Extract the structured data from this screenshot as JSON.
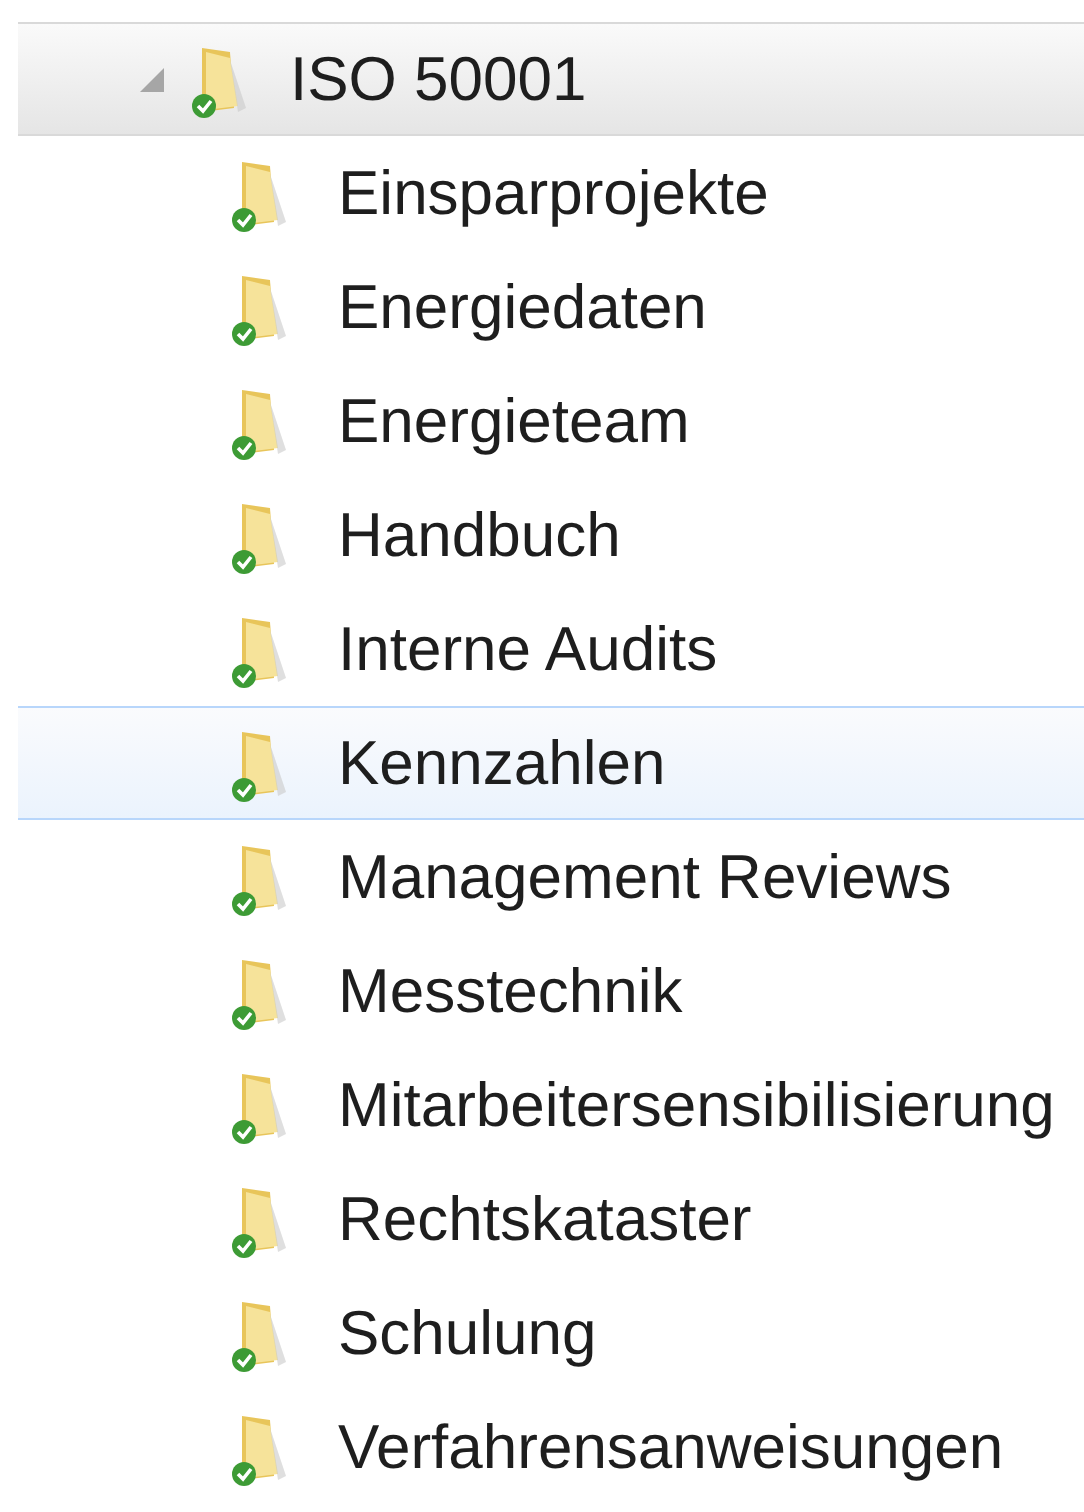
{
  "tree": {
    "label": "ISO 50001",
    "expanded": true,
    "selected": true,
    "children": [
      {
        "label": "Einsparprojekte",
        "selected": false,
        "hovered": false
      },
      {
        "label": "Energiedaten",
        "selected": false,
        "hovered": false
      },
      {
        "label": "Energieteam",
        "selected": false,
        "hovered": false
      },
      {
        "label": "Handbuch",
        "selected": false,
        "hovered": false
      },
      {
        "label": "Interne Audits",
        "selected": false,
        "hovered": false
      },
      {
        "label": "Kennzahlen",
        "selected": false,
        "hovered": true
      },
      {
        "label": "Management Reviews",
        "selected": false,
        "hovered": false
      },
      {
        "label": "Messtechnik",
        "selected": false,
        "hovered": false
      },
      {
        "label": "Mitarbeitersensibilisierung",
        "selected": false,
        "hovered": false
      },
      {
        "label": "Rechtskataster",
        "selected": false,
        "hovered": false
      },
      {
        "label": "Schulung",
        "selected": false,
        "hovered": false
      },
      {
        "label": "Verfahrensanweisungen",
        "selected": false,
        "hovered": false
      }
    ]
  }
}
